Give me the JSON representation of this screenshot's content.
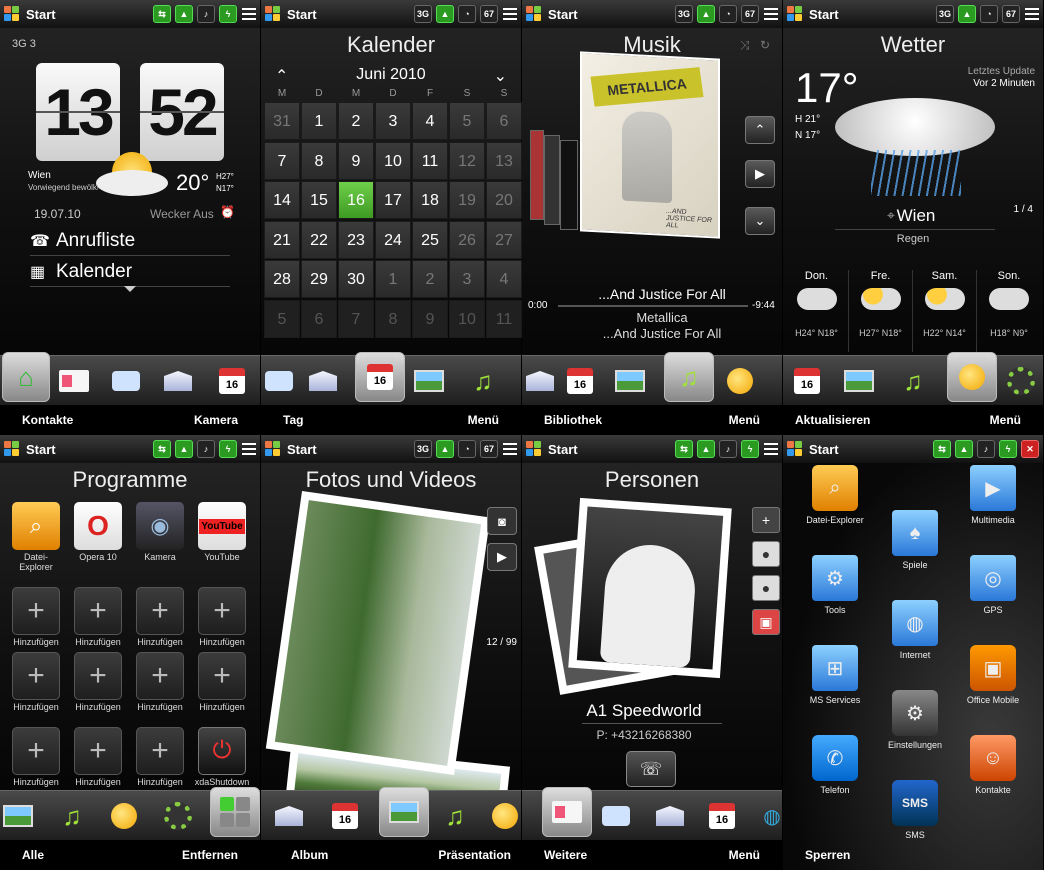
{
  "status_bar": {
    "start": "Start"
  },
  "icons": {
    "threeG": "3G",
    "sixSeven": "67"
  },
  "softkeys": [
    {
      "left": "Kontakte",
      "right": "Kamera"
    },
    {
      "left": "Tag",
      "right": "Menü"
    },
    {
      "left": "Bibliothek",
      "right": "Menü"
    },
    {
      "left": "Aktualisieren",
      "right": "Menü"
    },
    {
      "left": "Alle",
      "right": "Entfernen"
    },
    {
      "left": "Album",
      "right": "Präsentation"
    },
    {
      "left": "Weitere",
      "right": "Menü"
    },
    {
      "left": "Sperren",
      "right": ""
    }
  ],
  "home": {
    "network": "3G 3",
    "hour": "13",
    "minute": "52",
    "city": "Wien",
    "condition": "Vorwiegend bewölkt",
    "temp": "20°",
    "high": "H27°",
    "low": "N17°",
    "date": "19.07.10",
    "alarm": "Wecker Aus",
    "links": [
      "Anrufliste",
      "Kalender"
    ]
  },
  "calendar": {
    "title": "Kalender",
    "month": "Juni 2010",
    "weekdays": [
      "M",
      "D",
      "M",
      "D",
      "F",
      "S",
      "S"
    ],
    "weeks": [
      [
        "31",
        "1",
        "2",
        "3",
        "4",
        "5",
        "6"
      ],
      [
        "7",
        "8",
        "9",
        "10",
        "11",
        "12",
        "13"
      ],
      [
        "14",
        "15",
        "16",
        "17",
        "18",
        "19",
        "20"
      ],
      [
        "21",
        "22",
        "23",
        "24",
        "25",
        "26",
        "27"
      ],
      [
        "28",
        "29",
        "30",
        "1",
        "2",
        "3",
        "4"
      ],
      [
        "5",
        "6",
        "7",
        "8",
        "9",
        "10",
        "11"
      ]
    ],
    "today": "16",
    "tab_day": "16"
  },
  "music": {
    "title": "Musik",
    "album_logo": "METALLICA",
    "album_subtitle": "...AND JUSTICE FOR ALL",
    "track": "...And Justice For All",
    "artist": "Metallica",
    "album": "...And Justice For All",
    "elapsed": "0:00",
    "remaining": "-9:44",
    "progress": 0.0
  },
  "weather": {
    "title": "Wetter",
    "temp": "17°",
    "high": "21°",
    "low": "17°",
    "update_label": "Letztes Update",
    "update_value": "Vor 2 Minuten",
    "city": "Wien",
    "condition": "Regen",
    "page": "1 / 4",
    "days": [
      {
        "name": "Don.",
        "high": "H24°",
        "low": "N18°"
      },
      {
        "name": "Fre.",
        "high": "H27°",
        "low": "N18°"
      },
      {
        "name": "Sam.",
        "high": "H22°",
        "low": "N14°"
      },
      {
        "name": "Son.",
        "high": "H18°",
        "low": "N9°"
      }
    ]
  },
  "programs": {
    "title": "Programme",
    "apps": [
      {
        "label": "Datei-Explorer",
        "icon": "file-explorer-icon"
      },
      {
        "label": "Opera 10",
        "icon": "opera-icon"
      },
      {
        "label": "Kamera",
        "icon": "camera-icon"
      },
      {
        "label": "YouTube",
        "icon": "youtube-icon"
      }
    ],
    "add_label": "Hinzufügen",
    "last_label": "xdaShutdown",
    "youtube_text": "YouTube"
  },
  "photos": {
    "title": "Fotos und Videos",
    "counter": "12 / 99"
  },
  "people": {
    "title": "Personen",
    "name": "A1 Speedworld",
    "phone": "P: +43216268380"
  },
  "startmenu": {
    "items": [
      "Datei-Explorer",
      "Multimedia",
      "Spiele",
      "Tools",
      "GPS",
      "Internet",
      "MS Services",
      "Office Mobile",
      "Einstellungen",
      "Telefon",
      "Kontakte",
      "SMS"
    ],
    "sms_icon_text": "SMS"
  },
  "colors": {
    "accent_green": "#4aa82a",
    "close_red": "#cc2222"
  }
}
